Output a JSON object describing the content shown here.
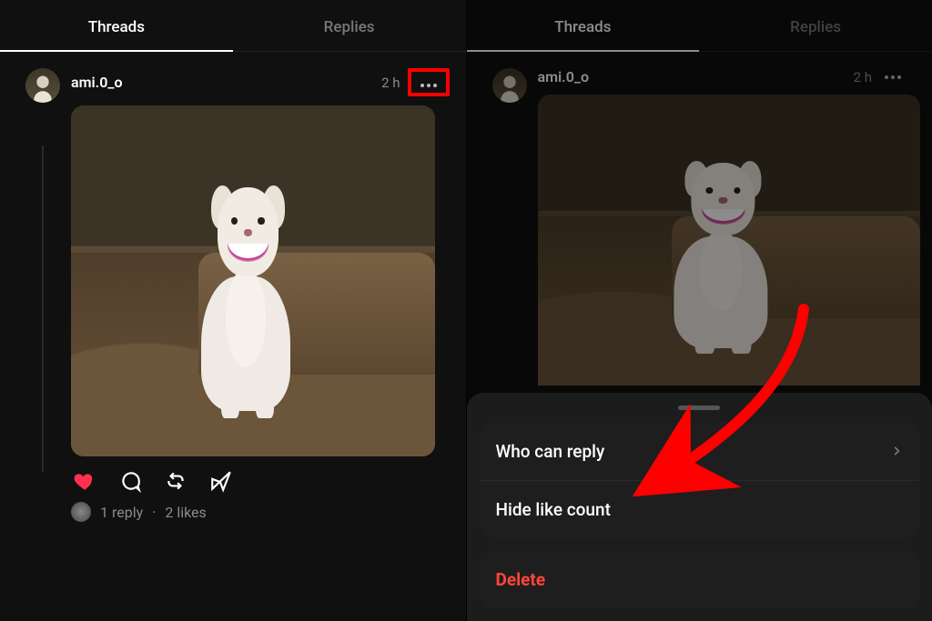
{
  "left": {
    "tabs": {
      "threads": "Threads",
      "replies": "Replies",
      "active_index": 0
    },
    "post": {
      "username": "ami.0_o",
      "timestamp": "2 h",
      "reply_text": "1 reply",
      "dot": "·",
      "likes_text": "2 likes"
    }
  },
  "right": {
    "tabs": {
      "threads": "Threads",
      "replies": "Replies",
      "active_index": 0
    },
    "post": {
      "username": "ami.0_o",
      "timestamp": "2 h"
    },
    "sheet": {
      "who_can_reply": "Who can reply",
      "hide_like_count": "Hide like count",
      "delete": "Delete"
    }
  },
  "icons": {
    "more": "more-icon",
    "heart": "heart-icon",
    "comment": "comment-icon",
    "repost": "repost-icon",
    "share": "share-icon",
    "chevron_right": "chevron-right-icon"
  },
  "colors": {
    "heart": "#ff3050",
    "highlight": "#ff0000",
    "delete": "#ff453a"
  }
}
